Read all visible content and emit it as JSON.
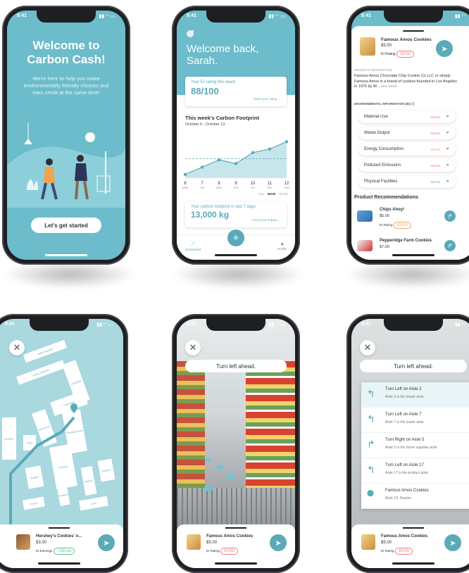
{
  "status_time": "9:41",
  "screen1": {
    "title": "Welcome to Carbon Cash!",
    "body": "We're here to help you make environmentally friendly choices and earn credit at the same time!",
    "cta": "Let's get started"
  },
  "screen2": {
    "greeting": "Welcome back, Sarah.",
    "rating_label": "Your EI rating this week:",
    "rating_value": "88/100",
    "track_rating": "Track your rating →",
    "footprint_title": "This week's Carbon Footprint",
    "date_range": "October 6 - October 13",
    "chart_data": {
      "type": "line",
      "x": [
        "6",
        "7",
        "8",
        "9",
        "10",
        "11",
        "12"
      ],
      "days": [
        "MON",
        "TUE",
        "WED",
        "THU",
        "FRI",
        "SAT",
        "SUN"
      ],
      "values": [
        1,
        3,
        5,
        4,
        7,
        8,
        10
      ],
      "ylim": [
        0,
        12
      ]
    },
    "periods": [
      "Day",
      "Week",
      "Month"
    ],
    "footprint_label": "Your carbon footprint in last 7 days",
    "footprint_value": "13,000 kg",
    "track_impact": "Track your impact →",
    "nav": [
      "Dashboard",
      "Profile"
    ]
  },
  "screen3": {
    "product_name": "Famous Amos Cookies",
    "price": "$5.00",
    "ei_label": "EI Rating",
    "ei_value": "35/100",
    "desc_heading": "PRODUCT DESCRIPTION",
    "desc": "Famous Amos Chocolate Chip Cookie Co LLC or simply Famous Amos is a brand of cookies founded in Los Angeles in 1975 by W...",
    "see_more": "see more",
    "env_heading": "ENVIRONMENTAL INFORMATION (EI)",
    "env_rows": [
      {
        "label": "Material Use",
        "score": "35/100",
        "color": "#ef7b7b"
      },
      {
        "label": "Waste Output",
        "score": "35/100",
        "color": "#ef7b7b"
      },
      {
        "label": "Energy Consumption",
        "score": "40/100",
        "color": "#f3a55b"
      },
      {
        "label": "Pollutant Emissions",
        "score": "25/100",
        "color": "#ef7b7b"
      },
      {
        "label": "Physical Facilities",
        "score": "80/100",
        "color": "#5bc08a"
      }
    ],
    "rec_heading": "Product Recommendations",
    "recs": [
      {
        "name": "Chips Ahoy!",
        "price": "$5.00",
        "ei": "EI Rating",
        "score": "61/100"
      },
      {
        "name": "Pepperidge Farm Cookies",
        "price": "$7.00"
      }
    ]
  },
  "screen4": {
    "aisles": [
      "Home Supplies",
      "House Supplies",
      "Cosmetics",
      "Electronics",
      "Cosmetics",
      "Prepared Food",
      "Chips",
      "Seafood",
      "Snacks",
      "Produce",
      "Bakery",
      "Produce",
      "Dairy",
      "Frozen",
      "Seafood"
    ],
    "product_name": "Hershey's Cookies' n...",
    "price": "$3.00",
    "ei_label": "EI Earnings",
    "ei_value": "+ 250 pts"
  },
  "screen5": {
    "instruction": "Turn left ahead.",
    "product_name": "Famous Amos Cookies",
    "price": "$5.00",
    "ei_label": "EI Rating",
    "ei_value": "35/100"
  },
  "screen6": {
    "instruction": "Turn left ahead.",
    "steps": [
      {
        "icon": "turn-left-icon",
        "title": "Turn Left on Aisle 2",
        "sub": "Aisle 2 is the snack aisle."
      },
      {
        "icon": "turn-left-icon",
        "title": "Turn Left on Aisle 7",
        "sub": "Aisle 7 is the snack aisle."
      },
      {
        "icon": "turn-right-icon",
        "title": "Turn Right on Aisle 5",
        "sub": "Aisle 5 is the home supplies aisle."
      },
      {
        "icon": "turn-left-icon",
        "title": "Turn Left on Aisle 17",
        "sub": "Aisle 17 is the product aisle."
      },
      {
        "icon": "pin-icon",
        "title": "Famous Amos Cookies",
        "sub": "Aisle 19: Snacks"
      }
    ],
    "product_name": "Famous Amos Cookies",
    "price": "$5.00",
    "ei_label": "EI Rating",
    "ei_value": "35/100"
  }
}
